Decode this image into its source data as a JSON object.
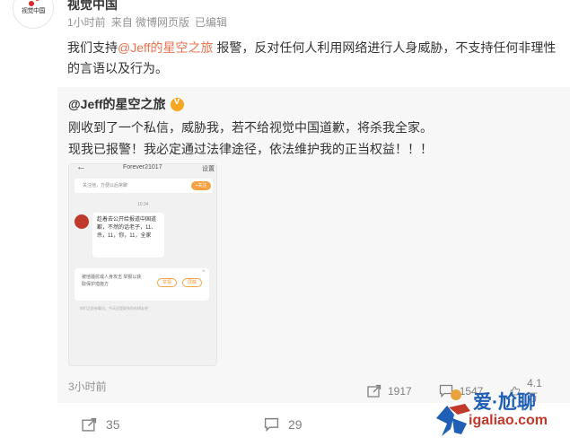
{
  "post": {
    "author": "视觉中国",
    "time": "1小时前",
    "source": "来自 微博网页版",
    "edited": "已编辑",
    "text_before": "我们支持",
    "mention": "@Jeff的星空之旅",
    "text_after": " 报警，反对任何人利用网络进行人身威胁，不支持任何非理性的言语以及行为。",
    "avatar_logo": "视觉中国"
  },
  "retweet": {
    "author": "@Jeff的星空之旅",
    "line1": "刚收到了一个私信，威胁我，若不给视觉中国道歉，将杀我全家。",
    "line2": "现我已报警！我必定通过法律途径，依法维护我的正当权益！！！",
    "time": "3小时前",
    "shares": "1917",
    "comments": "1547",
    "likes": "4.1万"
  },
  "screenshot": {
    "back": "←",
    "title": "Forever21017",
    "settings": "设置",
    "follow_hint": "关注他，方便以后常聊",
    "follow_button": "+关注",
    "time": "10:34",
    "message": "趁着去公开给报道中国道歉，不然的话老子，11、杀，11，你，11，全家",
    "report_text": "被他骚扰或人身攻击 举报以获取保护措施方",
    "report_button": "举报",
    "block_button": "屏蔽",
    "close": "×",
    "footer": "你们之前有聊过。今天还是联系你的朋友吧"
  },
  "actions": {
    "share_count": "35",
    "comment_count": "29"
  },
  "watermark": {
    "main": "爱·尬聊",
    "sub": "igaliao.com"
  },
  "colors": {
    "mention": "#eb7350",
    "retweet_bg": "#f7f7f7",
    "meta": "#939393",
    "badge": "#f5a623"
  }
}
